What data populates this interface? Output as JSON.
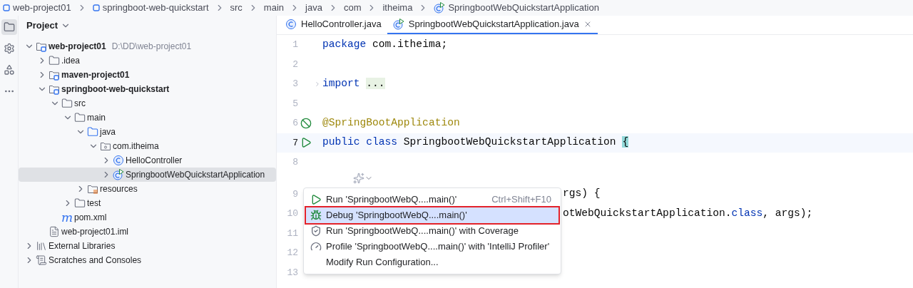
{
  "breadcrumbs": [
    {
      "label": "web-project01",
      "kind": "module"
    },
    {
      "label": "springboot-web-quickstart",
      "kind": "module"
    },
    {
      "label": "src",
      "kind": "plain"
    },
    {
      "label": "main",
      "kind": "plain"
    },
    {
      "label": "java",
      "kind": "plain"
    },
    {
      "label": "com",
      "kind": "plain"
    },
    {
      "label": "itheima",
      "kind": "plain"
    },
    {
      "label": "SpringbootWebQuickstartApplication",
      "kind": "spring"
    }
  ],
  "toolstrip": [
    {
      "kind": "project",
      "selected": true
    },
    {
      "kind": "settings",
      "selected": false
    },
    {
      "kind": "structure",
      "selected": false
    },
    {
      "kind": "more",
      "selected": false
    }
  ],
  "project_panel": {
    "title": "Project",
    "tree": [
      {
        "label": "web-project01",
        "path": "D:\\DD\\web-project01",
        "kind": "module",
        "bold": true,
        "expanded": true,
        "selected": false,
        "children": [
          {
            "label": ".idea",
            "kind": "folder",
            "bold": false,
            "expanded": false,
            "selected": false
          },
          {
            "label": "maven-project01",
            "kind": "module",
            "bold": true,
            "expanded": false,
            "selected": false
          },
          {
            "label": "springboot-web-quickstart",
            "kind": "module",
            "bold": true,
            "expanded": true,
            "selected": false,
            "children": [
              {
                "label": "src",
                "kind": "folder",
                "bold": false,
                "expanded": true,
                "selected": false,
                "children": [
                  {
                    "label": "main",
                    "kind": "folder",
                    "bold": false,
                    "expanded": true,
                    "selected": false,
                    "children": [
                      {
                        "label": "java",
                        "kind": "source",
                        "bold": false,
                        "expanded": true,
                        "selected": false,
                        "children": [
                          {
                            "label": "com.itheima",
                            "kind": "package",
                            "bold": false,
                            "expanded": true,
                            "selected": false,
                            "children": [
                              {
                                "label": "HelloController",
                                "kind": "class",
                                "bold": false,
                                "expanded": false,
                                "selected": false
                              },
                              {
                                "label": "SpringbootWebQuickstartApplication",
                                "kind": "spring",
                                "bold": false,
                                "expanded": false,
                                "selected": true
                              }
                            ]
                          }
                        ]
                      },
                      {
                        "label": "resources",
                        "kind": "resources",
                        "bold": false,
                        "expanded": false,
                        "selected": false
                      }
                    ]
                  },
                  {
                    "label": "test",
                    "kind": "folder",
                    "bold": false,
                    "expanded": false,
                    "selected": false
                  }
                ]
              },
              {
                "label": "pom.xml",
                "kind": "maven",
                "glyph": "m",
                "bold": false,
                "selected": false
              }
            ]
          },
          {
            "label": "web-project01.iml",
            "kind": "file",
            "bold": false,
            "selected": false
          }
        ]
      },
      {
        "label": "External Libraries",
        "kind": "library",
        "bold": false,
        "expanded": false,
        "selected": false
      },
      {
        "label": "Scratches and Consoles",
        "kind": "scratch",
        "bold": false,
        "expanded": false,
        "selected": false
      }
    ]
  },
  "editor_tabs": [
    {
      "label": "HelloController.java",
      "kind": "class",
      "selected": false
    },
    {
      "label": "SpringbootWebQuickstartApplication.java",
      "kind": "spring",
      "selected": true
    }
  ],
  "code_lines": [
    {
      "number": "1",
      "kind": "plain",
      "current": false,
      "tokens": [
        {
          "text": "package",
          "kind": "keyword"
        },
        {
          "text": " com.itheima;",
          "kind": "plain"
        }
      ]
    },
    {
      "number": "2",
      "kind": "plain",
      "current": false
    },
    {
      "number": "3",
      "kind": "folded",
      "current": false,
      "tokens": [
        {
          "text": "import",
          "kind": "keyword"
        },
        {
          "text": "...",
          "kind": "folded"
        }
      ]
    },
    {
      "number": "5",
      "kind": "plain",
      "current": false
    },
    {
      "number": "6",
      "kind": "bean_marker",
      "current": false,
      "tokens": [
        {
          "text": "@SpringBootApplication",
          "kind": "annotation"
        }
      ]
    },
    {
      "number": "7",
      "kind": "run_marker",
      "current": true,
      "tokens": [
        {
          "text": "public class",
          "kind": "keyword"
        },
        {
          "text": " SpringbootWebQuickstartApplication ",
          "kind": "plain"
        },
        {
          "text": "{",
          "kind": "brace"
        }
      ]
    },
    {
      "number": "8",
      "kind": "plain",
      "current": false
    },
    {
      "kind": "inlay_hint"
    },
    {
      "number": "9",
      "kind": "behind_menu",
      "current": false,
      "tokens": [
        {
          "text": "rgs) {",
          "kind": "plain"
        }
      ]
    },
    {
      "number": "10",
      "kind": "behind_menu",
      "current": false,
      "tokens": [
        {
          "text": "otWebQuickstartApplication.",
          "kind": "plain"
        },
        {
          "text": "class",
          "kind": "keyword"
        },
        {
          "text": ", args);",
          "kind": "plain"
        }
      ]
    },
    {
      "number": "11",
      "kind": "plain",
      "current": false
    },
    {
      "number": "12",
      "kind": "plain",
      "current": false
    },
    {
      "number": "13",
      "kind": "plain",
      "current": false
    }
  ],
  "context_menu": {
    "items": [
      {
        "kind": "run",
        "label": "Run 'SpringbootWebQ....main()'",
        "shortcut": "Ctrl+Shift+F10",
        "selected": false
      },
      {
        "kind": "debug",
        "label": "Debug 'SpringbootWebQ....main()'",
        "selected": true
      },
      {
        "kind": "coverage",
        "label": "Run 'SpringbootWebQ....main()' with Coverage",
        "selected": false
      },
      {
        "kind": "profile",
        "label": "Profile 'SpringbootWebQ....main()' with 'IntelliJ Profiler'",
        "selected": false
      },
      {
        "kind": "plain",
        "label": "Modify Run Configuration...",
        "selected": false
      }
    ]
  }
}
